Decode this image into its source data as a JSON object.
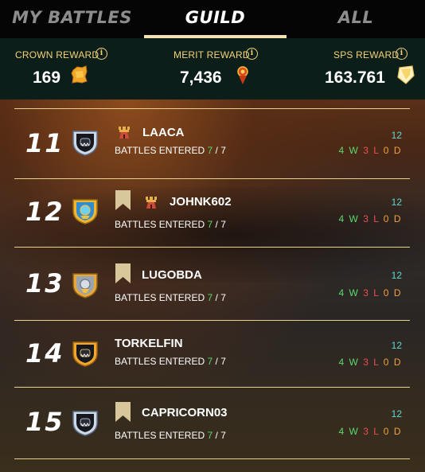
{
  "tabs": [
    {
      "label": "MY BATTLES",
      "active": false
    },
    {
      "label": "GUILD",
      "active": true
    },
    {
      "label": "ALL",
      "active": false
    }
  ],
  "rewards": {
    "crown": {
      "label": "CROWN REWARD",
      "value": "169",
      "icon": "crown-reward-icon"
    },
    "merit": {
      "label": "MERIT REWARD",
      "value": "7,436",
      "icon": "merit-reward-icon"
    },
    "sps": {
      "label": "SPS REWARD",
      "value": "163.761",
      "icon": "sps-reward-icon"
    }
  },
  "battles_label": "BATTLES ENTERED",
  "players": [
    {
      "rank": "11",
      "name": "LAACA",
      "entered": "7",
      "total": "7",
      "score": "12",
      "w": "4",
      "l": "3",
      "d": "0",
      "avatar": "black-skull-avatar",
      "banner": false,
      "tower": true
    },
    {
      "rank": "12",
      "name": "JOHNK602",
      "entered": "7",
      "total": "7",
      "score": "12",
      "w": "4",
      "l": "3",
      "d": "0",
      "avatar": "blue-gold-avatar",
      "banner": true,
      "tower": true
    },
    {
      "rank": "13",
      "name": "LUGOBDA",
      "entered": "7",
      "total": "7",
      "score": "12",
      "w": "4",
      "l": "3",
      "d": "0",
      "avatar": "silver-gold-avatar",
      "banner": true,
      "tower": false
    },
    {
      "rank": "14",
      "name": "TORKELFIN",
      "entered": "7",
      "total": "7",
      "score": "12",
      "w": "4",
      "l": "3",
      "d": "0",
      "avatar": "orange-skull-avatar",
      "banner": false,
      "tower": false
    },
    {
      "rank": "15",
      "name": "CAPRICORN03",
      "entered": "7",
      "total": "7",
      "score": "12",
      "w": "4",
      "l": "3",
      "d": "0",
      "avatar": "black-skull-avatar",
      "banner": true,
      "tower": false
    }
  ],
  "units": {
    "w": "W",
    "l": "L",
    "d": "D"
  },
  "colors": {
    "accent": "#f4e2b3",
    "reward_label": "#f3d279",
    "score": "#5fd7d0",
    "win": "#5bd86c",
    "loss": "#e85050",
    "draw": "#f0a040",
    "entered": "#58d86b"
  }
}
